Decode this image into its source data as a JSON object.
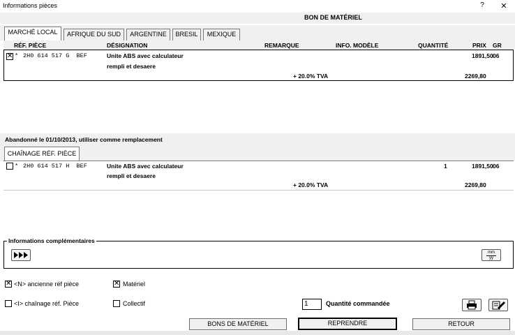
{
  "window": {
    "title": "Informations pièces",
    "help": "?",
    "close": "✕"
  },
  "page_title": "BON DE MATÉRIEL",
  "tabs": [
    {
      "label": "MARCHÉ LOCAL",
      "active": true
    },
    {
      "label": "AFRIQUE DU SUD"
    },
    {
      "label": "ARGENTINE"
    },
    {
      "label": "BRESIL"
    },
    {
      "label": "MEXIQUE"
    }
  ],
  "columns": {
    "ref": "RÉF. PIÈCE",
    "designation": "DÉSIGNATION",
    "remarque": "REMARQUE",
    "info_modele": "INFO. MODÈLE",
    "quantite": "QUANTITÉ",
    "prix": "PRIX",
    "gr": "GR"
  },
  "main_item": {
    "checked": true,
    "star": "*",
    "ref": "2H0 614 517 G  BEF",
    "designation_line1": "Unite ABS avec calculateur",
    "designation_line2": "rempli et desaere",
    "quantite": "",
    "prix": "1891,50",
    "gr": "06",
    "tva_label": "+ 20.0% TVA",
    "tva_price": "2269,80"
  },
  "abandon_note": "Abandonné le 01/10/2013, utiliser comme remplacement",
  "chain_tab": "CHAÎNAGE RÉF. PIÈCE",
  "chain_item": {
    "checked": false,
    "star": "*",
    "ref": "2H0 614 517 H  BEF",
    "designation_line1": "Unite ABS avec calculateur",
    "designation_line2": "rempli et desaere",
    "quantite": "1",
    "prix": "1891,50",
    "gr": "06",
    "tva_label": "+ 20.0% TVA",
    "tva_price": "2269,80"
  },
  "info_section": {
    "label": "Informations complémentaires",
    "arrow_icon": "fast-forward-icon",
    "date_icon": "month-year-icon",
    "date_top": "mm",
    "date_bottom": "yy"
  },
  "options": {
    "old_ref": {
      "label": "<N> ancienne réf pièce",
      "checked": true
    },
    "chain_ref": {
      "label": "<I> chaînage réf. Pièce",
      "checked": false
    },
    "materiel": {
      "label": "Matériel",
      "checked": true
    },
    "collectif": {
      "label": "Collectif",
      "checked": false
    }
  },
  "quantity": {
    "value": "1",
    "label": "Quantité commandée"
  },
  "buttons": {
    "bons": "BONS DE MATÉRIEL",
    "reprendre": "REPRENDRE",
    "retour": "RETOUR"
  },
  "colors": {
    "panel": "#f0f0f0",
    "border": "#000000"
  }
}
